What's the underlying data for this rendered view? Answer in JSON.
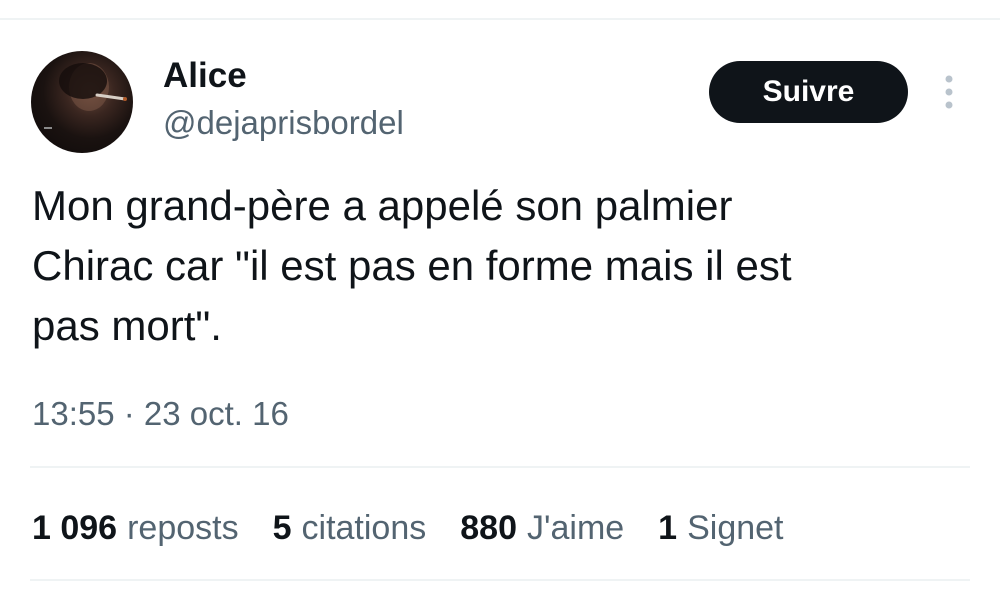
{
  "author": {
    "name": "Alice",
    "handle": "@dejaprisbordel"
  },
  "follow_button": {
    "label": "Suivre"
  },
  "more_menu": {
    "icon": "more-vertical-icon"
  },
  "tweet": {
    "text": "Mon grand-père a appelé son palmier\nChirac car \"il est pas en forme mais il est\npas mort\".",
    "timestamp": "13:55 · 23 oct. 16"
  },
  "stats": [
    {
      "count": "1 096",
      "label": "reposts"
    },
    {
      "count": "5",
      "label": "citations"
    },
    {
      "count": "880",
      "label": "J'aime"
    },
    {
      "count": "1",
      "label": "Signet"
    }
  ],
  "colors": {
    "text_primary": "#0f1419",
    "text_secondary": "#536471",
    "divider": "#eff3f4",
    "button_bg": "#0f1419",
    "button_text": "#ffffff"
  }
}
